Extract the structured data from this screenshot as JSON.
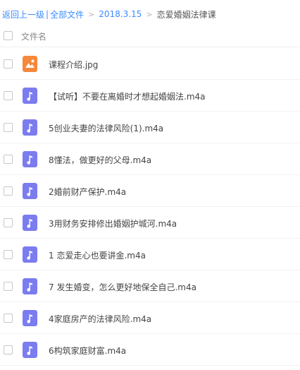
{
  "breadcrumb": {
    "back": "返回上一级",
    "pipe": "|",
    "all_files": "全部文件",
    "sep": ">",
    "folder": "2018.3.15",
    "current": "恋爱婚姻法律课"
  },
  "header": {
    "column_title": "文件名"
  },
  "colors": {
    "link": "#3b8cff",
    "image_icon": "#f5883b",
    "audio_icon": "#7b7cf0"
  },
  "files": [
    {
      "name": "课程介绍.jpg",
      "icon": "image-icon"
    },
    {
      "name": "【试听】不要在离婚时才想起婚姻法.m4a",
      "icon": "music-note-icon"
    },
    {
      "name": "5创业夫妻的法律风险(1).m4a",
      "icon": "music-note-icon"
    },
    {
      "name": "8懂法，做更好的父母.m4a",
      "icon": "music-note-icon"
    },
    {
      "name": "2婚前财产保护.m4a",
      "icon": "music-note-icon"
    },
    {
      "name": "3用财务安排修出婚姻护城河.m4a",
      "icon": "music-note-icon"
    },
    {
      "name": "1 恋爱走心也要讲金.m4a",
      "icon": "music-note-icon"
    },
    {
      "name": "7 发生婚变，怎么更好地保全自己.m4a",
      "icon": "music-note-icon"
    },
    {
      "name": "4家庭房产的法律风险.m4a",
      "icon": "music-note-icon"
    },
    {
      "name": "6构筑家庭财富.m4a",
      "icon": "music-note-icon"
    }
  ]
}
